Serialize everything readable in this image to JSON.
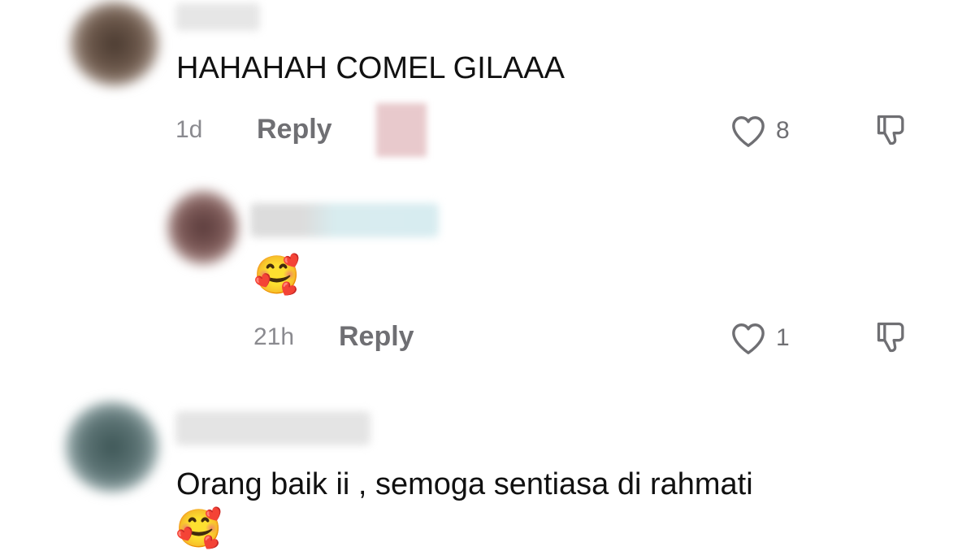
{
  "comments": [
    {
      "text": "HAHAHAH COMEL GILAAA",
      "time": "1d",
      "reply_label": "Reply",
      "like_count": "8",
      "icons": [
        "heart-outline-icon",
        "dislike-icon"
      ]
    },
    {
      "is_reply": true,
      "text": "🥰",
      "time": "21h",
      "reply_label": "Reply",
      "like_count": "1",
      "icons": [
        "heart-outline-icon",
        "dislike-icon"
      ]
    },
    {
      "text": "Orang baik ii , semoga sentiasa di rahmati",
      "text_line2": "🥰"
    }
  ],
  "colors": {
    "text": "#111111",
    "meta": "#8a8a8f",
    "icon": "#6f6f73"
  }
}
